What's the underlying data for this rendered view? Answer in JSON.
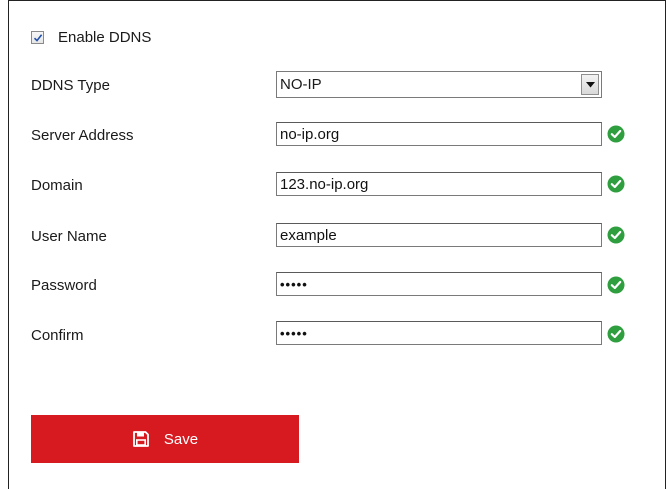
{
  "enable": {
    "label": "Enable DDNS",
    "checked": true
  },
  "fields": {
    "ddns_type": {
      "label": "DDNS Type",
      "value": "NO-IP"
    },
    "server_address": {
      "label": "Server Address",
      "value": "no-ip.org"
    },
    "domain": {
      "label": "Domain",
      "value": "123.no-ip.org"
    },
    "user_name": {
      "label": "User Name",
      "value": "example"
    },
    "password": {
      "label": "Password",
      "value": "•••••"
    },
    "confirm": {
      "label": "Confirm",
      "value": "•••••"
    }
  },
  "save": {
    "label": "Save"
  },
  "colors": {
    "accent_red": "#d71920",
    "valid_green": "#2e9e3e"
  },
  "icons": {
    "check": "checkmark-icon",
    "valid": "valid-check-icon",
    "dropdown": "chevron-down-icon",
    "save": "floppy-disk-icon"
  }
}
